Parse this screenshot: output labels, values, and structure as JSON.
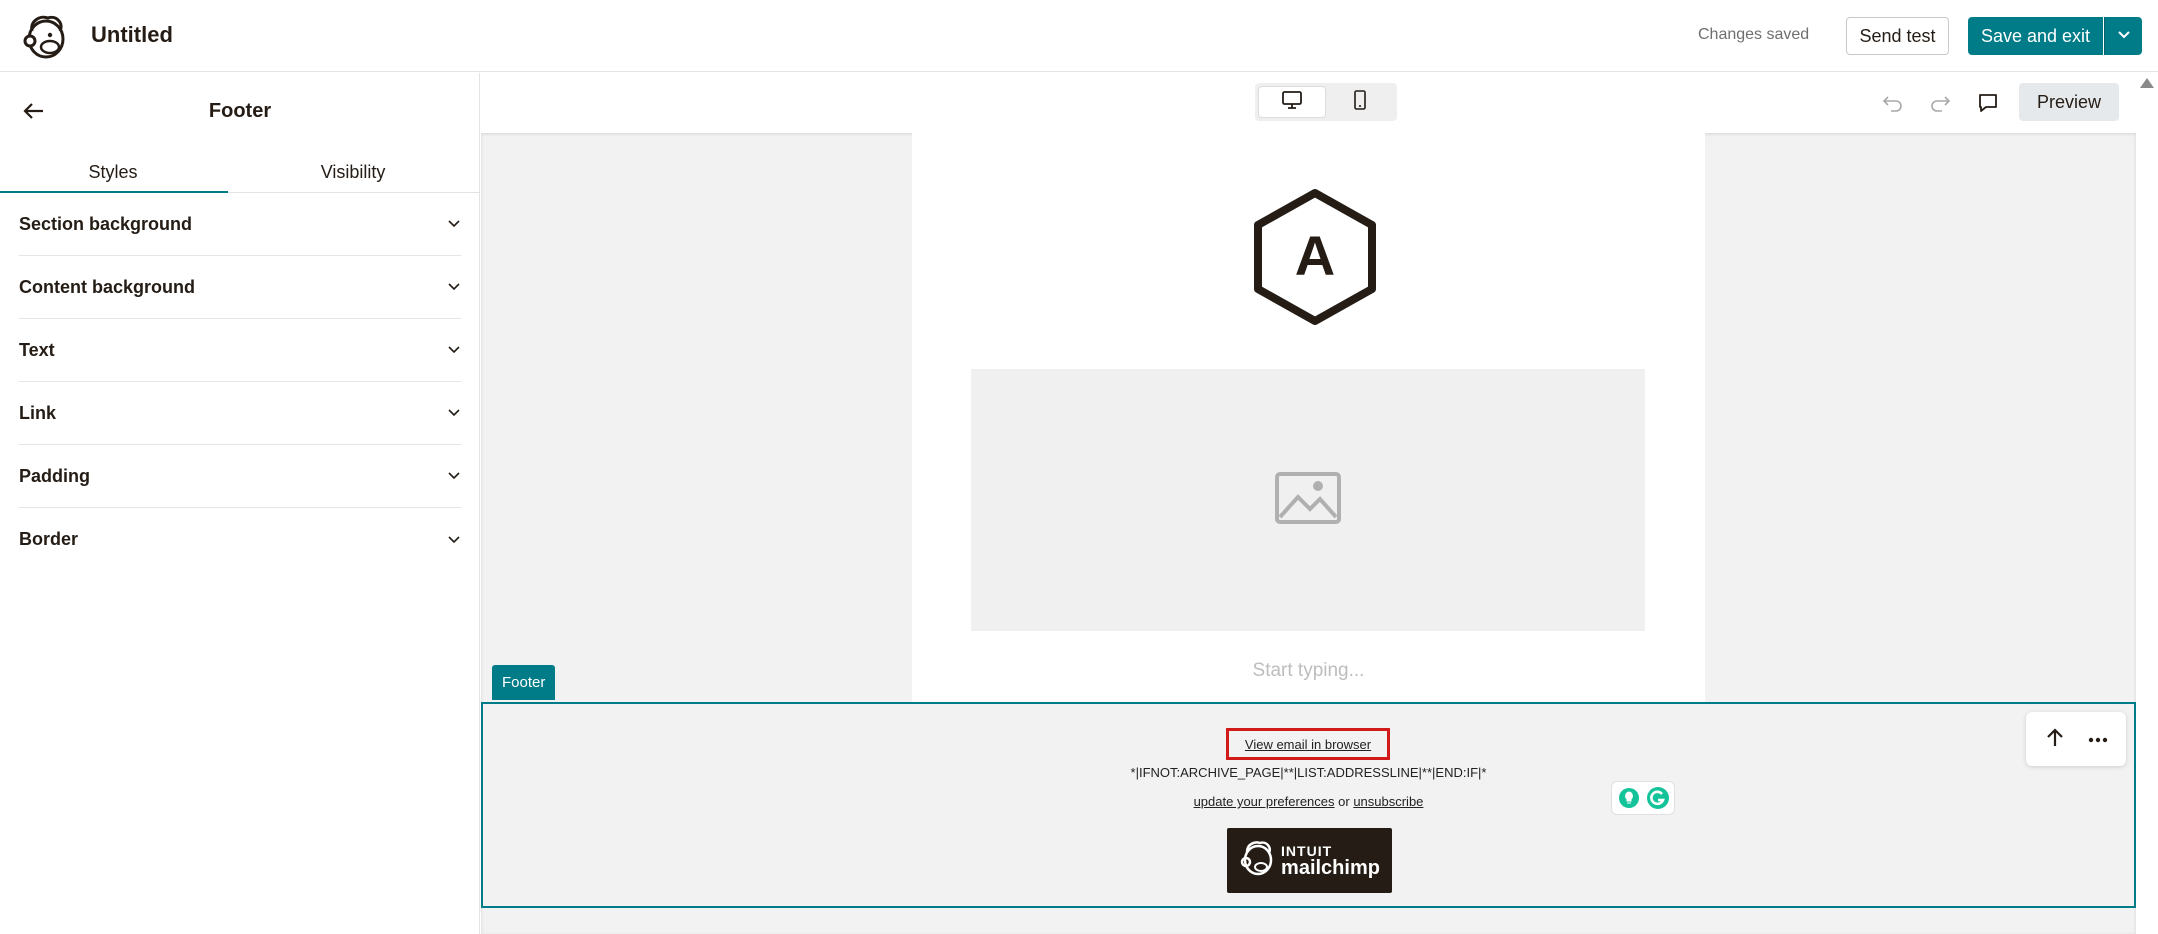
{
  "header": {
    "title": "Untitled",
    "status": "Changes saved",
    "send_test_label": "Send test",
    "save_exit_label": "Save and exit"
  },
  "left_panel": {
    "title": "Footer",
    "tabs": [
      {
        "label": "Styles",
        "active": true
      },
      {
        "label": "Visibility",
        "active": false
      }
    ],
    "sections": [
      {
        "label": "Section background"
      },
      {
        "label": "Content background"
      },
      {
        "label": "Text"
      },
      {
        "label": "Link"
      },
      {
        "label": "Padding"
      },
      {
        "label": "Border"
      }
    ]
  },
  "toolbar": {
    "preview_label": "Preview",
    "device_selected": "desktop"
  },
  "canvas": {
    "logo_letter": "A",
    "placeholder_text": "Start typing...",
    "footer_tag": "Footer",
    "footer": {
      "view_in_browser": "View email in browser",
      "merge_tags": "*|IFNOT:ARCHIVE_PAGE|**|LIST:ADDRESSLINE|**|END:IF|*",
      "update_prefs": "update your preferences",
      "or_text": " or ",
      "unsubscribe": "unsubscribe",
      "badge_top": "INTUIT",
      "badge_bottom": "mailchimp"
    }
  },
  "colors": {
    "accent": "#007c89",
    "highlight_box": "#d11a1a",
    "canvas_bg": "#f2f2f2"
  }
}
